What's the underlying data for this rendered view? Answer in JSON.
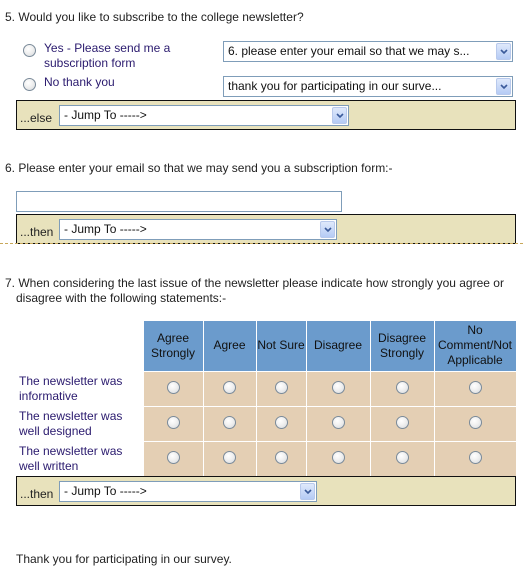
{
  "q5": {
    "title": "5. Would you like to subscribe to the college newsletter?",
    "options": [
      {
        "label": "Yes - Please send me a subscription form",
        "selected": false,
        "jump_value": "6. please enter your email so that we may s..."
      },
      {
        "label": "No thank you",
        "selected": false,
        "jump_value": "thank you for participating in our surve..."
      }
    ],
    "else_label": "...else",
    "else_jump": "- Jump To ----->"
  },
  "q6": {
    "title": "6. Please enter your email so that we may send you a subscription form:-",
    "input_value": "",
    "then_label": "...then",
    "then_jump": "- Jump To ----->"
  },
  "q7": {
    "title_line1": "7. When considering the last issue of the newsletter please indicate how strongly you agree or",
    "title_line2": "disagree with the following statements:-",
    "columns": [
      "Agree Strongly",
      "Agree",
      "Not Sure",
      "Disagree",
      "Disagree Strongly",
      "No Comment/Not Applicable"
    ],
    "rows": [
      {
        "label": "The newsletter was informative"
      },
      {
        "label": "The newsletter was well designed"
      },
      {
        "label": "The newsletter was well written"
      }
    ],
    "then_label": "...then",
    "then_jump": "- Jump To ----->"
  },
  "closing": "Thank you for participating in our survey.",
  "colors": {
    "header_blue": "#6b9bcc",
    "cell_tan": "#e4cfb4",
    "jump_bar": "#e8e2bc",
    "option_text": "#2a1a6e"
  }
}
